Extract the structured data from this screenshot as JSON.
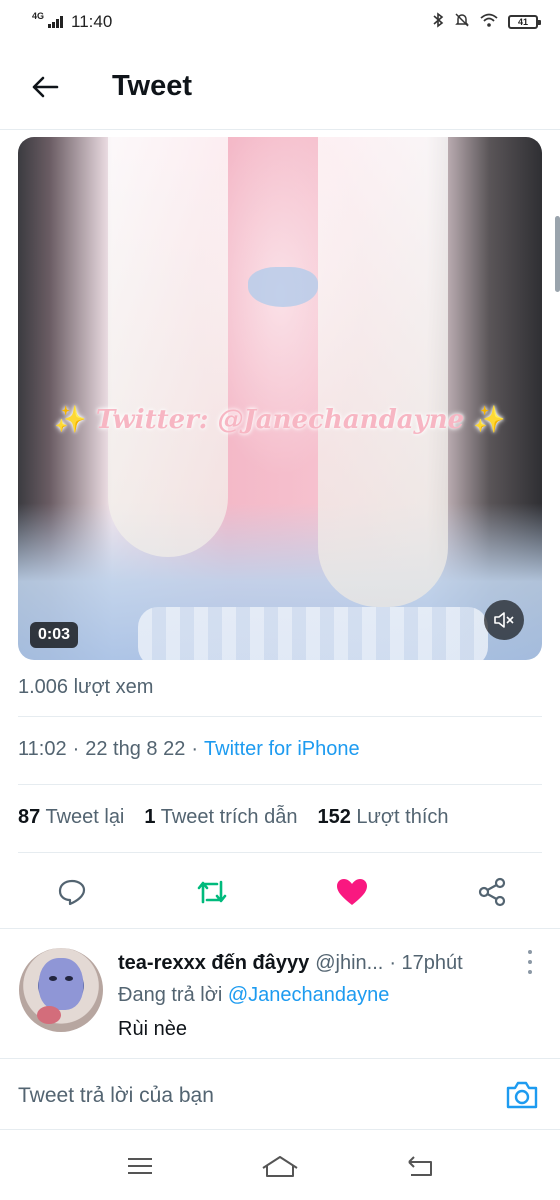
{
  "status_bar": {
    "network": "4G",
    "time": "11:40",
    "battery": "41"
  },
  "header": {
    "title": "Tweet"
  },
  "media": {
    "watermark": "Twitter: @Janechandayne",
    "duration": "0:03"
  },
  "views": "1.006 lượt xem",
  "meta": {
    "time": "11:02",
    "dot1": "·",
    "date": "22 thg 8 22",
    "dot2": "·",
    "source": "Twitter for iPhone"
  },
  "stats": {
    "retweets_count": "87",
    "retweets_label": "Tweet lại",
    "quotes_count": "1",
    "quotes_label": "Tweet trích dẫn",
    "likes_count": "152",
    "likes_label": "Lượt thích"
  },
  "actions": {
    "like_color": "#f91880",
    "retweet_color": "#00ba7c"
  },
  "reply": {
    "name": "tea-rexxx đến đâyyy",
    "handle": "@jhin...",
    "time": "· 17phút",
    "replying_prefix": "Đang trả lời",
    "replying_to": "@Janechandayne",
    "text": "Rùi nèe"
  },
  "compose": {
    "placeholder": "Tweet trả lời của bạn"
  },
  "colors": {
    "accent": "#1d9bf0",
    "secondary_text": "#536471"
  }
}
